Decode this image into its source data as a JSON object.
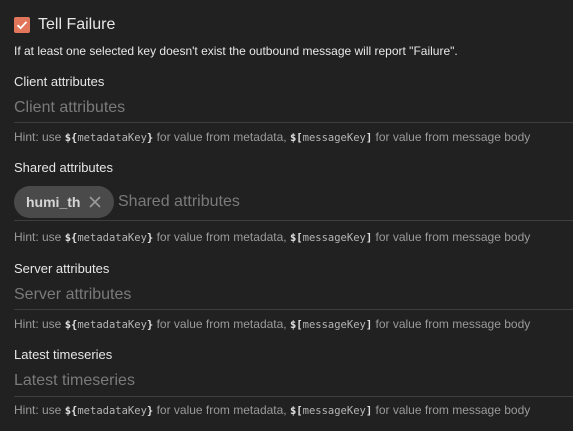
{
  "checkbox": {
    "label": "Tell Failure",
    "checked": true,
    "color": "#e2765a"
  },
  "info": "If at least one selected key doesn't exist the outbound message will report \"Failure\".",
  "hint": {
    "prefix": "Hint: use ",
    "metadata_sym": "${",
    "metadata_key": "metadataKey",
    "metadata_close": "}",
    "middle": " for value from metadata, ",
    "message_sym": "$[",
    "message_key": "messageKey",
    "message_close": "]",
    "suffix": " for value from message body"
  },
  "sections": {
    "client": {
      "label": "Client attributes",
      "placeholder": "Client attributes"
    },
    "shared": {
      "label": "Shared attributes",
      "placeholder": "Shared attributes",
      "chips": [
        "humi_th"
      ]
    },
    "server": {
      "label": "Server attributes",
      "placeholder": "Server attributes"
    },
    "latest": {
      "label": "Latest timeseries",
      "placeholder": "Latest timeseries"
    }
  }
}
